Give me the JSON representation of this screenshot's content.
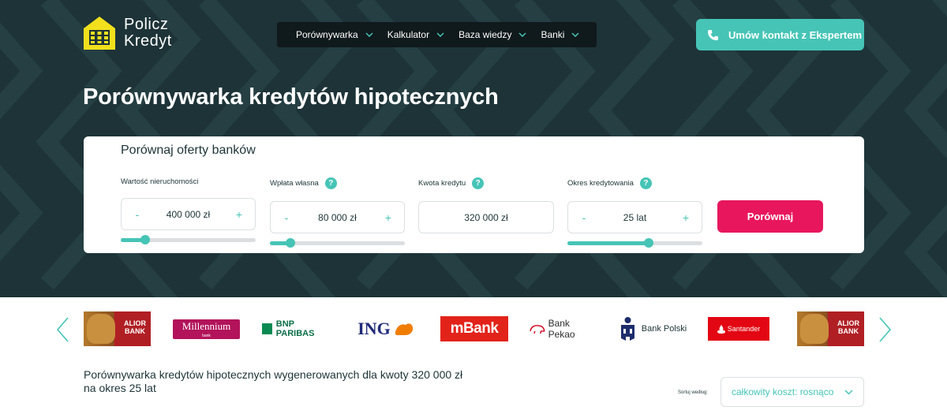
{
  "logo": {
    "line1": "Policz",
    "line2": "Kredyt",
    "icon": "house-calculator-logo"
  },
  "nav": {
    "items": [
      {
        "label": "Porównywarka",
        "icon": "chevron-down-icon"
      },
      {
        "label": "Kalkulator",
        "icon": "chevron-down-icon"
      },
      {
        "label": "Baza wiedzy",
        "icon": "chevron-down-icon"
      },
      {
        "label": "Banki",
        "icon": "chevron-down-icon"
      }
    ]
  },
  "cta": {
    "label": "Umów kontakt z Ekspertem",
    "icon": "phone-icon"
  },
  "page_title": "Porównywarka kredytów hipotecznych",
  "calculator": {
    "title": "Porównaj oferty banków",
    "fields": [
      {
        "label": "Wartość nieruchomości",
        "value": "400 000 zł",
        "minus": "-",
        "plus": "+",
        "has_help": false,
        "slider_level": 0.18
      },
      {
        "label": "Wpłata własna",
        "value": "80 000 zł",
        "minus": "-",
        "plus": "+",
        "has_help": true,
        "help": "?",
        "slider_level": 0.15
      },
      {
        "label": "Kwota kredytu",
        "value": "320 000 zł",
        "has_help": true,
        "help": "?"
      },
      {
        "label": "Okres kredytowania",
        "value": "25",
        "unit": "lat",
        "minus": "-",
        "plus": "+",
        "has_help": true,
        "help": "?",
        "slider_level": 0.6
      }
    ],
    "submit_label": "Porównaj"
  },
  "banks": [
    {
      "name": "Alior Bank",
      "line1": "ALIOR",
      "line2": "BANK"
    },
    {
      "name": "Millennium",
      "line1": "Millennium",
      "line2": "bank"
    },
    {
      "name": "BNP PARIBAS"
    },
    {
      "name": "ING"
    },
    {
      "name": "mBank"
    },
    {
      "name": "Bank Pekao"
    },
    {
      "name": "Bank Polski"
    },
    {
      "name": "Santander"
    },
    {
      "name": "Alior Bank",
      "line1": "ALIOR",
      "line2": "BANK"
    }
  ],
  "results": {
    "summary_line1": "Porównywarka kredytów hipotecznych wygenerowanych dla kwoty 320 000 zł",
    "summary_line2": "na okres 25 lat",
    "sort_label": "Sortuj według:",
    "sort_value": "całkowity koszt: rosnąco"
  },
  "colors": {
    "hero_bg": "#1d3337",
    "accent_teal": "#46c4b6",
    "accent_pink": "#e8175d",
    "logo_yellow": "#f2e01c"
  }
}
